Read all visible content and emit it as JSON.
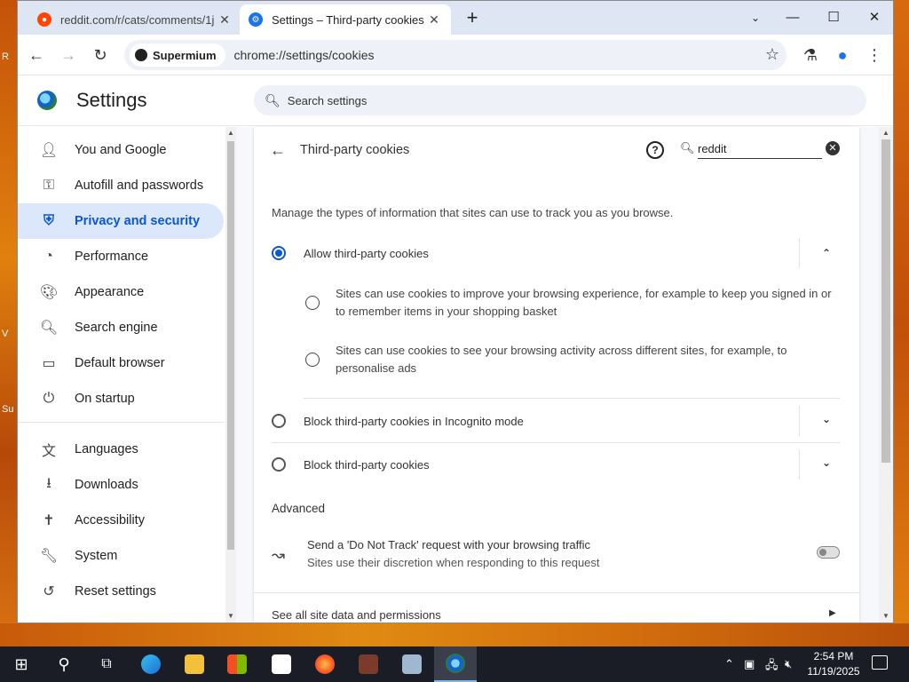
{
  "tabs": [
    {
      "title": "reddit.com/r/cats/comments/1j",
      "icon": "reddit-icon"
    },
    {
      "title": "Settings – Third-party cookies",
      "icon": "gear-icon"
    }
  ],
  "toolbar": {
    "site_chip": "Supermium",
    "url": "chrome://settings/cookies"
  },
  "header": {
    "title": "Settings",
    "search_placeholder": "Search settings"
  },
  "sidebar": {
    "items": [
      {
        "label": "You and Google",
        "icon": "person-icon"
      },
      {
        "label": "Autofill and passwords",
        "icon": "key-icon"
      },
      {
        "label": "Privacy and security",
        "icon": "shield-icon",
        "selected": true
      },
      {
        "label": "Performance",
        "icon": "speedometer-icon"
      },
      {
        "label": "Appearance",
        "icon": "palette-icon"
      },
      {
        "label": "Search engine",
        "icon": "search-icon"
      },
      {
        "label": "Default browser",
        "icon": "browser-window-icon"
      },
      {
        "label": "On startup",
        "icon": "power-icon"
      },
      {
        "label": "Languages",
        "icon": "translate-icon"
      },
      {
        "label": "Downloads",
        "icon": "download-icon"
      },
      {
        "label": "Accessibility",
        "icon": "accessibility-icon"
      },
      {
        "label": "System",
        "icon": "wrench-icon"
      },
      {
        "label": "Reset settings",
        "icon": "reset-icon"
      }
    ]
  },
  "page": {
    "title": "Third-party cookies",
    "search_value": "reddit",
    "description": "Manage the types of information that sites can use to track you as you browse.",
    "options": [
      {
        "label": "Allow third-party cookies",
        "checked": true,
        "expanded": true
      },
      {
        "label": "Block third-party cookies in Incognito mode",
        "checked": false,
        "expanded": false
      },
      {
        "label": "Block third-party cookies",
        "checked": false,
        "expanded": false
      }
    ],
    "allow_details": [
      "Sites can use cookies to improve your browsing experience, for example to keep you signed in or to remember items in your shopping basket",
      "Sites can use cookies to see your browsing activity across different sites, for example, to personalise ads"
    ],
    "advanced_heading": "Advanced",
    "dnt": {
      "title": "Send a 'Do Not Track' request with your browsing traffic",
      "subtitle": "Sites use their discretion when responding to this request",
      "enabled": false
    },
    "see_all_link": "See all site data and permissions"
  },
  "taskbar": {
    "time": "2:54 PM",
    "date": "11/19/2025"
  },
  "desktop": {
    "labels": [
      "R",
      "V",
      "Su"
    ]
  }
}
